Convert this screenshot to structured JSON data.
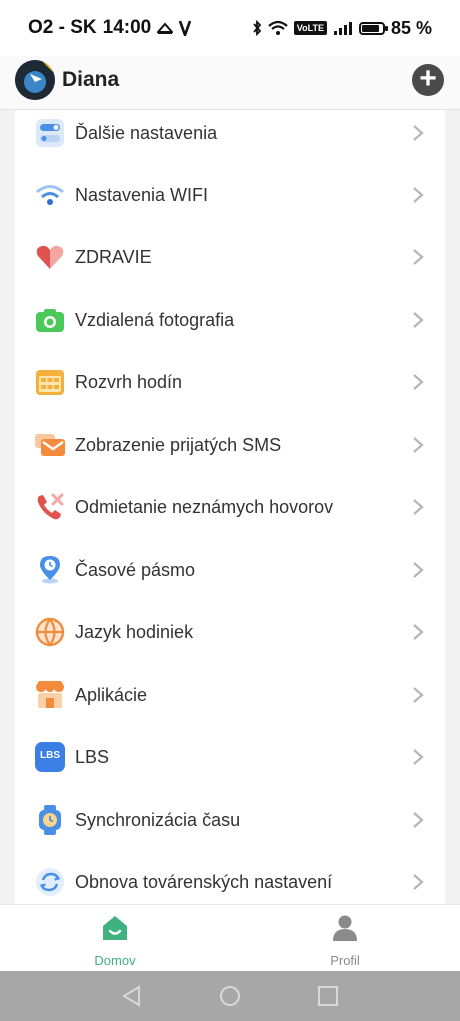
{
  "status_bar": {
    "carrier": "O2 - SK",
    "time": "14:00",
    "battery_percent": "85 %",
    "battery_level": 0.85,
    "network": "VoLTE"
  },
  "header": {
    "device_name": "Diana",
    "add_label": "+"
  },
  "settings": {
    "items": [
      {
        "label": "Ďalšie nastavenia",
        "icon": "toggle-settings-icon"
      },
      {
        "label": "Nastavenia WIFI",
        "icon": "wifi-icon"
      },
      {
        "label": "ZDRAVIE",
        "icon": "heart-icon"
      },
      {
        "label": "Vzdialená fotografia",
        "icon": "camera-icon"
      },
      {
        "label": "Rozvrh hodín",
        "icon": "schedule-icon"
      },
      {
        "label": "Zobrazenie prijatých SMS",
        "icon": "sms-icon"
      },
      {
        "label": "Odmietanie neznámych hovorov",
        "icon": "reject-call-icon"
      },
      {
        "label": "Časové pásmo",
        "icon": "location-clock-icon"
      },
      {
        "label": "Jazyk hodiniek",
        "icon": "globe-icon"
      },
      {
        "label": "Aplikácie",
        "icon": "store-icon"
      },
      {
        "label": "LBS",
        "icon": "lbs-icon"
      },
      {
        "label": "Synchronizácia času",
        "icon": "watch-icon"
      },
      {
        "label": "Obnova továrenských nastavení",
        "icon": "refresh-icon"
      }
    ]
  },
  "bottom_nav": {
    "home_label": "Domov",
    "profile_label": "Profil",
    "active_color": "#3fb27f",
    "inactive_color": "#8a8a8a"
  },
  "lbs_badge": "LBS"
}
